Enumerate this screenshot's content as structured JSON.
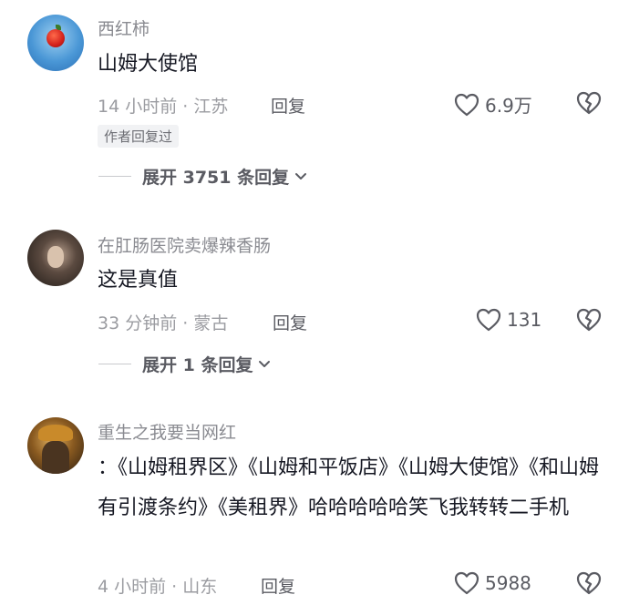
{
  "comments": [
    {
      "username": "西红柿",
      "text": "山姆大使馆",
      "time_location": "14 小时前 · 江苏",
      "reply_label": "回复",
      "likes": "6.9万",
      "badge": "作者回复过",
      "expand": "展开 3751 条回复",
      "avatar_icon": "red-apple-on-blue-avatar"
    },
    {
      "username": "在肛肠医院卖爆辣香肠",
      "text": "这是真值",
      "time_location": "33 分钟前 · 蒙古",
      "reply_label": "回复",
      "likes": "131",
      "expand": "展开 1 条回复",
      "avatar_icon": "person-photo-avatar"
    },
    {
      "username": "重生之我要当网红",
      "text": "：《山姆租界区》《山姆和平饭店》《山姆大使馆》《和山姆有引渡条约》《美租界》哈哈哈哈哈笑飞我转转二手机",
      "time_location": "4 小时前 · 山东",
      "reply_label": "回复",
      "likes": "5988",
      "avatar_icon": "person-with-hat-avatar"
    }
  ],
  "icons": {
    "like": "heart-outline-icon",
    "dislike": "broken-heart-icon",
    "expand": "chevron-down-icon"
  },
  "colors": {
    "username": "#8a8b91",
    "text": "#161823",
    "meta": "#9b9ca1",
    "badge_bg": "#f1f2f4"
  }
}
